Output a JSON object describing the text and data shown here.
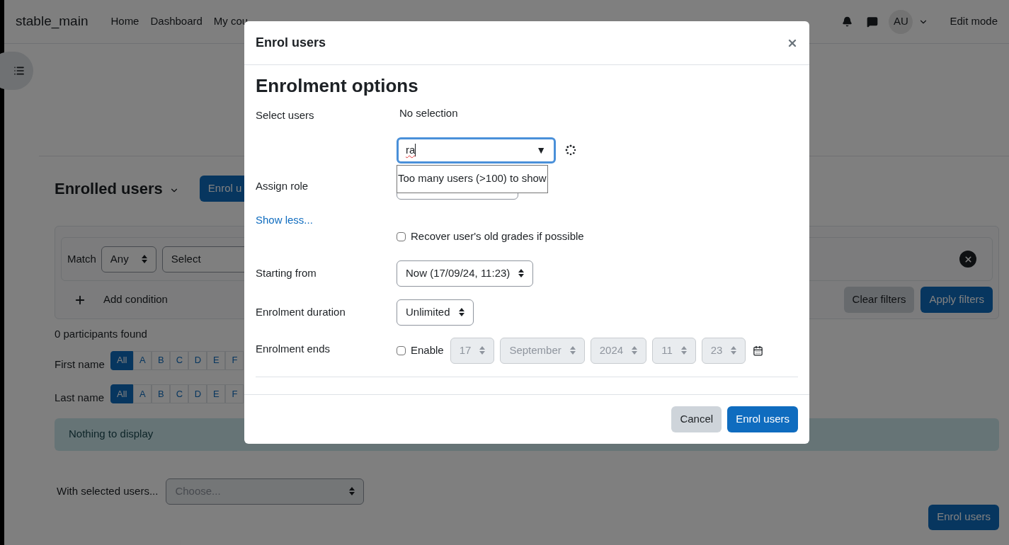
{
  "navbar": {
    "site_name": "stable_main",
    "links": [
      "Home",
      "Dashboard",
      "My cou"
    ],
    "avatar": "AU",
    "edit_mode": "Edit mode"
  },
  "page": {
    "heading": "Enrolled users",
    "enrol_button": "Enrol u",
    "filters": {
      "match_label": "Match",
      "match_value": "Any",
      "condition_value": "Select",
      "add_condition": "Add condition",
      "clear_button": "Clear filters",
      "apply_button": "Apply filters"
    },
    "participants_found": "0 participants found",
    "initials_bars": [
      {
        "label": "First name",
        "letters": [
          {
            "label": "All",
            "selected": true
          },
          {
            "label": "A",
            "selected": false
          },
          {
            "label": "B",
            "selected": false
          },
          {
            "label": "C",
            "selected": false
          },
          {
            "label": "D",
            "selected": false
          },
          {
            "label": "E",
            "selected": false
          },
          {
            "label": "F",
            "selected": false
          }
        ]
      },
      {
        "label": "Last name",
        "letters": [
          {
            "label": "All",
            "selected": true
          },
          {
            "label": "A",
            "selected": false
          },
          {
            "label": "B",
            "selected": false
          },
          {
            "label": "C",
            "selected": false
          },
          {
            "label": "D",
            "selected": false
          },
          {
            "label": "E",
            "selected": false
          },
          {
            "label": "F",
            "selected": false
          }
        ]
      }
    ],
    "alert": "Nothing to display",
    "bulk_action": {
      "label": "With selected users...",
      "placeholder": "Choose..."
    },
    "bottom_button": "Enrol users"
  },
  "modal": {
    "title": "Enrol users",
    "heading": "Enrolment options",
    "fields": [
      {
        "kind": "user_picker",
        "label": "Select users",
        "selection": "No selection",
        "value": "ra",
        "arrow": "▼",
        "suggestion": "Too many users (>100) to show"
      },
      {
        "kind": "select",
        "label": "Assign role"
      },
      {
        "kind": "link",
        "text": "Show less..."
      },
      {
        "kind": "checkbox",
        "text": "Recover user's old grades if possible",
        "checked": false
      },
      {
        "kind": "select",
        "label": "Starting from",
        "value": "Now (17/09/24, 11:23)"
      },
      {
        "kind": "select",
        "label": "Enrolment duration",
        "value": "Unlimited"
      },
      {
        "kind": "date",
        "label": "Enrolment ends",
        "enable": {
          "text": "Enable",
          "checked": false
        },
        "parts": [
          {
            "value": "17",
            "disabled": true
          },
          {
            "value": "September",
            "disabled": true
          },
          {
            "value": "2024",
            "disabled": true
          },
          {
            "value": "11",
            "disabled": true
          },
          {
            "value": "23",
            "disabled": true
          }
        ]
      }
    ],
    "buttons": [
      {
        "label": "Cancel",
        "kind": "secondary"
      },
      {
        "label": "Enrol users",
        "kind": "primary"
      }
    ]
  }
}
